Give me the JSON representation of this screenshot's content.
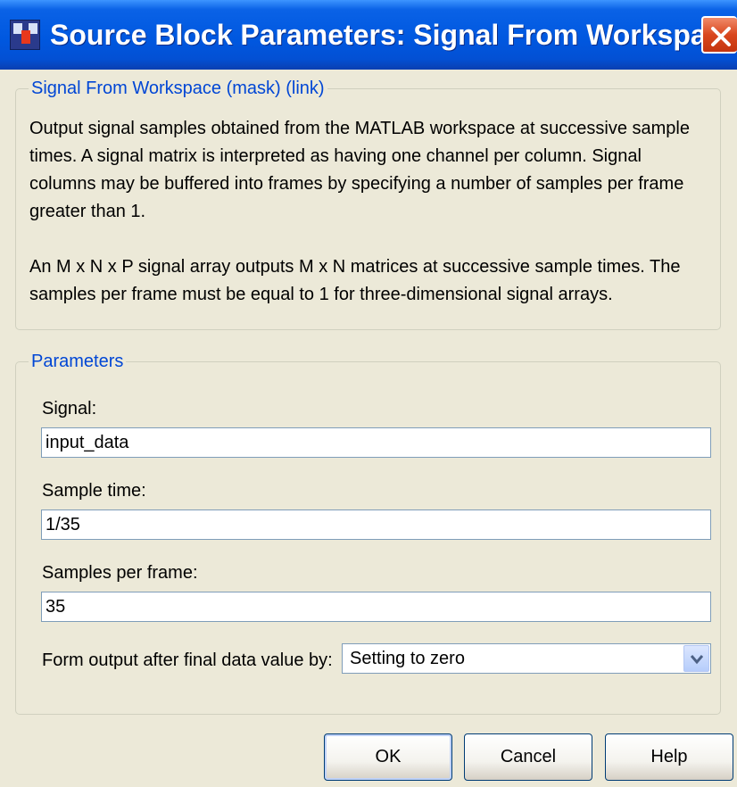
{
  "window": {
    "title": "Source Block Parameters: Signal From Workspace",
    "icon": "simulink-block-icon",
    "close_icon": "close-icon"
  },
  "description_group": {
    "legend": "Signal From Workspace (mask) (link)",
    "paragraph1_lines": [
      "Output signal samples obtained from the MATLAB workspace at successive sample",
      "times.  A signal matrix is interpreted as having one channel per column.  Signal",
      "columns may be buffered into frames by specifying a number of samples per frame",
      "greater than 1."
    ],
    "paragraph2_lines": [
      "An M x N x P signal array outputs M x N matrices at successive sample times.  The",
      "samples per frame must be equal to 1 for three-dimensional signal arrays."
    ]
  },
  "parameters_group": {
    "legend": "Parameters",
    "signal": {
      "label": "Signal:",
      "value": "input_data"
    },
    "sample_time": {
      "label": "Sample time:",
      "value": "1/35"
    },
    "samples_per_frame": {
      "label": "Samples per frame:",
      "value": "35"
    },
    "form_output": {
      "label": "Form output after final data value by:",
      "selected": "Setting to zero"
    }
  },
  "buttons": {
    "ok": "OK",
    "cancel": "Cancel",
    "help": "Help"
  },
  "colors": {
    "titlebar": "#0058e0",
    "legend_text": "#0046d5",
    "dialog_bg": "#ece9d8",
    "close_button": "#d9471e"
  }
}
